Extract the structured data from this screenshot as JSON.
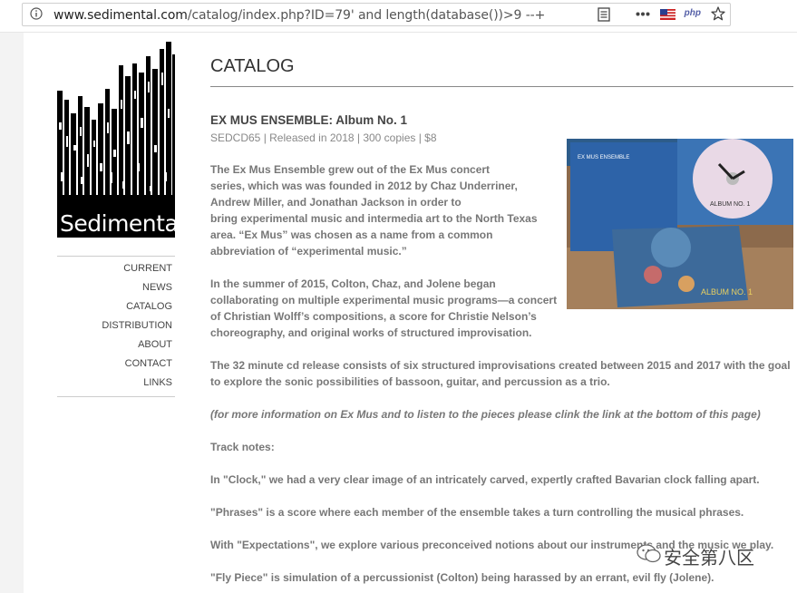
{
  "browser": {
    "url_domain": "www.sedimental.com",
    "url_path": "/catalog/index.php?ID=79' and length(database())>9 --+",
    "php_badge": "php"
  },
  "site": {
    "logo_text": "Sedimental",
    "nav": [
      "CURRENT",
      "NEWS",
      "CATALOG",
      "DISTRIBUTION",
      "ABOUT",
      "CONTACT",
      "LINKS"
    ]
  },
  "page": {
    "title": "CATALOG",
    "album_title": "EX MUS ENSEMBLE: Album No. 1",
    "album_meta": "SEDCD65 | Released in 2018 | 300 copies | $8",
    "image_labels": {
      "cover_title": "EX MUS ENSEMBLE",
      "disc_label": "ALBUM NO. 1",
      "case_label": "ALBUM NO. 1"
    },
    "para1": [
      "The Ex Mus Ensemble grew out of the Ex Mus concert",
      "series, which was was founded in 2012 by Chaz Underriner,",
      "Andrew Miller, and Jonathan Jackson in order to",
      "bring experimental music and intermedia art to the North Texas",
      "area. “Ex Mus” was chosen as a name from a common",
      "abbreviation of “experimental music.”"
    ],
    "para2": [
      "In the summer of 2015, Colton, Chaz, and Jolene began",
      "collaborating on multiple experimental music programs—a concert",
      "of Christian Wolff’s compositions, a score for Christie Nelson’s",
      "choreography, and original works of structured improvisation."
    ],
    "para3": [
      "The 32 minute cd release consists of six structured improvisations created between 2015 and 2017 with the goal",
      "to explore the sonic possibilities of bassoon, guitar, and percussion as a trio."
    ],
    "para4": "(for more information on Ex Mus and to listen to the pieces please clink the link at the bottom of this page)",
    "track_notes_label": "Track notes:",
    "note1": "In \"Clock,\" we had a very clear image of an intricately carved, expertly crafted Bavarian clock falling apart.",
    "note2": "\"Phrases\" is a score where each member of the ensemble takes a turn controlling the musical phrases.",
    "note3": "With \"Expectations\", we explore various preconceived notions about our instruments and the music we play.",
    "note4": "\"Fly Piece\" is simulation of a percussionist (Colton) being harassed by an errant, evil fly (Jolene)."
  },
  "watermark": {
    "text": "安全第八区"
  }
}
